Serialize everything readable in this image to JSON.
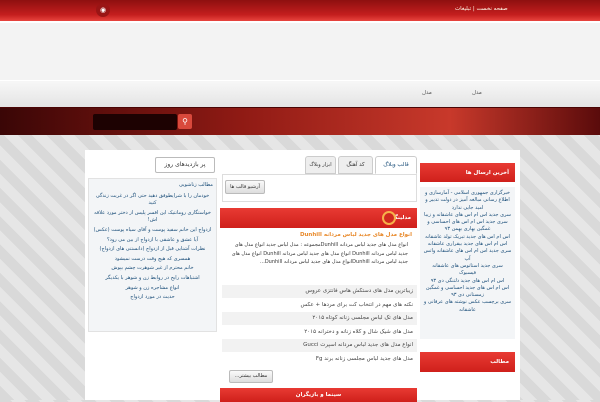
{
  "topbar": {
    "links": "صفحه نخست | تبلیغات",
    "rss_icon": "rss-icon"
  },
  "nav": {
    "items": [
      "مدل",
      "مدل"
    ]
  },
  "search": {
    "placeholder": "",
    "button_icon": "search-icon"
  },
  "tabs": [
    {
      "label": "قالب وبلاگ",
      "active": true
    },
    {
      "label": "کد آهنگ"
    },
    {
      "label": "ابزار وبلاگ نویسی"
    }
  ],
  "tab_content": {
    "button": "آرشیو قالب ها"
  },
  "modeling": {
    "header": "مدلینگ",
    "post_title": "انواع مدل های جدید لباس مردانه Dunhill",
    "post_text": "انواع مدل های جدید لباس مردانه Dunhillمجموعه : مدل لباس جدید انواع مدل های جدید لباس مردانه Dunhill  انواع مدل های جدید لباس مردانه Dunhill  انواع مدل های جدید لباس مردانه Dunhillانواع مدل های جدید لباس مردانه Dunhill...",
    "list": [
      "زیباترین مدل های دستکش هاس فانتزی عروس",
      "نکته های مهم در انتخاب کت برای مردها + عکس",
      "مدل های تک لباس مجلسی زنانه کوتاه ۲۰۱۵",
      "مدل های شیک شال و کلاه زنانه و دخترانه ۲۰۱۵",
      "انواع مدل های جدید لباس مردانه اسپرت Gucci",
      "مدل های جدید لباس مجلسی زنانه برند Fg"
    ],
    "more_button": "مطالب بیشتر..."
  },
  "cinema": {
    "header": "سینما و بازیگران"
  },
  "left": {
    "title": "پر بازدیدهای روز",
    "items": [
      "مطالب زناشویی",
      "خودمان را با شرایطوفق دهید حتی اگر در غربت زندگی کنید",
      "خواستگاری رومانتیک این افسر پلیس از دختر مورد علاقه اش!",
      "ازدواج این خانم سفید پوست و آقای سیاه پوست (عکس)",
      "آیا عشق و عاشقی با ازدواج از بین می رود؟",
      "نظرات آشنایی قبل از ازدواج (دانستنی های ازدواج)",
      "همسری که هیچ وقت درست نمیشود",
      "خانم محترم از غیر شوهرت چشم بپوش",
      "اشتباهات رایج در روابط زن و شوهر با یکدیگر",
      "انواع مشاجره زن و شوهر",
      "حدیث در مورد ازدواج"
    ]
  },
  "right": {
    "header": "آخرین ارسال ها",
    "items": [
      "خبرگزاری جمهوری اسلامی - آمارسازی و اطلاع رسانی مبالغه آمیز در دولت تدبیر و امید جایی ندارد",
      "سری جدید اس ام اس های عاشقانه و زیبا",
      "سری جدید اس ام اس های احساسی و غمگین بهاری بهمن ۹۳",
      "اس ام اس های جدید تبریک تولد عاشقانه",
      "اس ام اس های جدید بیقراری عاشقانه",
      "سری جدید اس ام اس های عاشقانه واتس آپ",
      "سری جدید استاتوس های عاشقانه فیسبوک",
      "اس ام اس های جدید دلتنگی دی ۹۳",
      "اس ام اس های جدید احساسی و غمگین زمستانی دی ۹۳",
      "سری برچسب عکس نوشته های عرفانی و عاشقانه"
    ],
    "header2": "مطالب"
  }
}
